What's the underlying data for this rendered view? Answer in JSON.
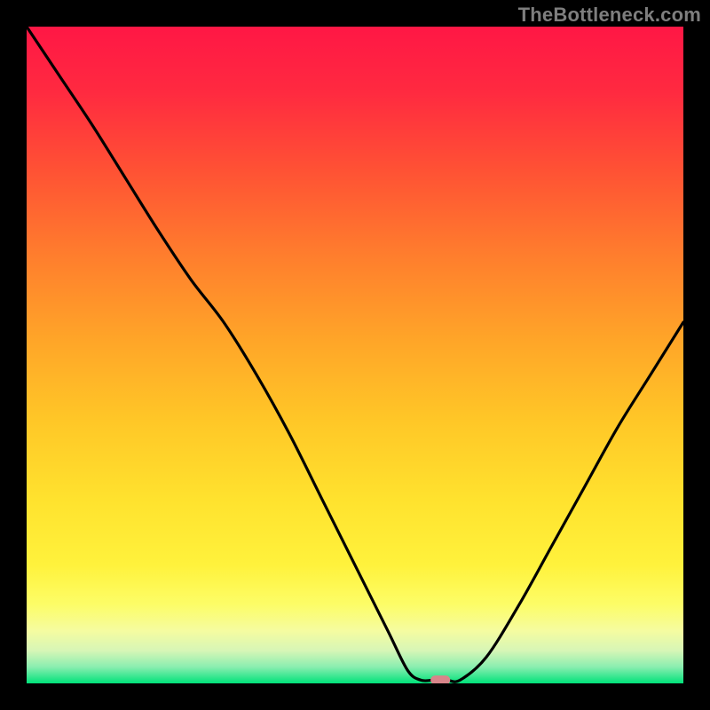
{
  "watermark": "TheBottleneck.com",
  "chart_data": {
    "type": "line",
    "title": "",
    "xlabel": "",
    "ylabel": "",
    "xlim": [
      0,
      100
    ],
    "ylim": [
      0,
      100
    ],
    "series": [
      {
        "name": "curve",
        "x": [
          0,
          5,
          10,
          15,
          20,
          25,
          30,
          35,
          40,
          45,
          50,
          55,
          58,
          60,
          62,
          64,
          66,
          70,
          75,
          80,
          85,
          90,
          95,
          100
        ],
        "y": [
          100,
          92.5,
          85,
          77,
          69,
          61.5,
          55,
          47,
          38,
          28,
          18,
          8,
          2,
          0.5,
          0.5,
          0.5,
          0.5,
          4,
          12,
          21,
          30,
          39,
          47,
          55
        ]
      }
    ],
    "marker": {
      "x": 63,
      "y": 0.5,
      "width": 3,
      "height": 1.4,
      "color": "#d8858a"
    },
    "background_gradient": {
      "stops": [
        {
          "offset": 0.0,
          "color": "#ff1745"
        },
        {
          "offset": 0.1,
          "color": "#ff2a40"
        },
        {
          "offset": 0.22,
          "color": "#ff5234"
        },
        {
          "offset": 0.35,
          "color": "#ff7e2d"
        },
        {
          "offset": 0.48,
          "color": "#ffa628"
        },
        {
          "offset": 0.6,
          "color": "#ffc727"
        },
        {
          "offset": 0.72,
          "color": "#ffe22e"
        },
        {
          "offset": 0.82,
          "color": "#fff23c"
        },
        {
          "offset": 0.88,
          "color": "#fdfd67"
        },
        {
          "offset": 0.92,
          "color": "#f5fca0"
        },
        {
          "offset": 0.95,
          "color": "#d7f6b6"
        },
        {
          "offset": 0.975,
          "color": "#8aeeb0"
        },
        {
          "offset": 1.0,
          "color": "#00e27a"
        }
      ]
    }
  }
}
